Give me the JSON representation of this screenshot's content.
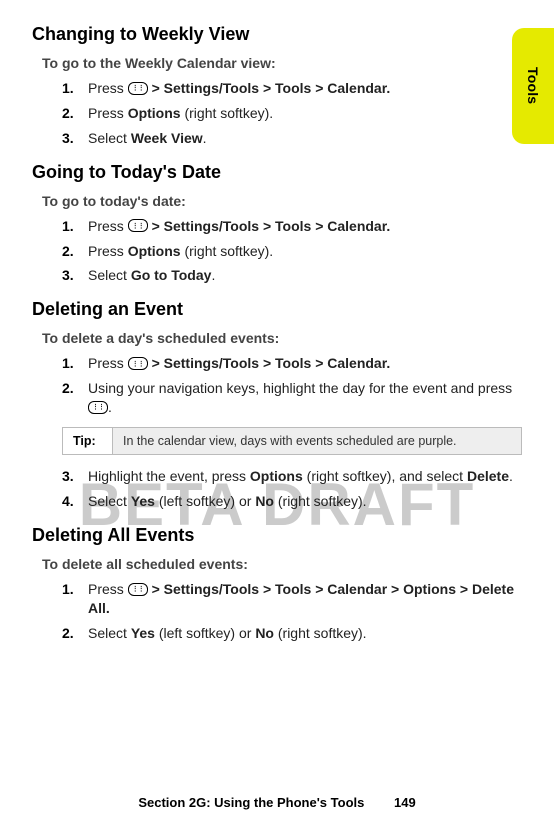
{
  "side_tab": "Tools",
  "watermark": "BETA DRAFT",
  "sections": {
    "weekly": {
      "heading": "Changing to Weekly View",
      "lead": "To go to the Weekly Calendar view:",
      "steps": {
        "s1_a": "Press ",
        "s1_b": " > Settings/Tools > Tools > Calendar.",
        "s2_a": "Press ",
        "s2_b": "Options",
        "s2_c": " (right softkey).",
        "s3_a": "Select ",
        "s3_b": "Week View",
        "s3_c": "."
      }
    },
    "today": {
      "heading": "Going to Today's Date",
      "lead": "To go to today's date:",
      "steps": {
        "s1_a": "Press ",
        "s1_b": " > Settings/Tools > Tools > Calendar.",
        "s2_a": "Press ",
        "s2_b": "Options",
        "s2_c": " (right softkey).",
        "s3_a": "Select ",
        "s3_b": "Go to Today",
        "s3_c": "."
      }
    },
    "delevent": {
      "heading": "Deleting an Event",
      "lead": "To delete a day's scheduled events:",
      "steps": {
        "s1_a": "Press ",
        "s1_b": " > Settings/Tools > Tools > Calendar.",
        "s2_a": "Using your navigation keys, highlight the day for the event and press ",
        "s2_b": ".",
        "s3_a": "Highlight the event, press ",
        "s3_b": "Options",
        "s3_c": " (right softkey), and select ",
        "s3_d": "Delete",
        "s3_e": ".",
        "s4_a": "Select ",
        "s4_b": "Yes",
        "s4_c": " (left softkey) or ",
        "s4_d": "No",
        "s4_e": " (right softkey)."
      },
      "tip_label": "Tip:",
      "tip_text": "In the calendar view, days with events scheduled are purple."
    },
    "delall": {
      "heading": "Deleting All Events",
      "lead": "To delete all scheduled events:",
      "steps": {
        "s1_a": "Press ",
        "s1_b": " > Settings/Tools > Tools > Calendar > Options > Delete All.",
        "s2_a": "Select ",
        "s2_b": "Yes",
        "s2_c": " (left softkey) or ",
        "s2_d": "No",
        "s2_e": " (right softkey)."
      }
    }
  },
  "footer": {
    "text": "Section 2G: Using the Phone's Tools",
    "page": "149"
  }
}
